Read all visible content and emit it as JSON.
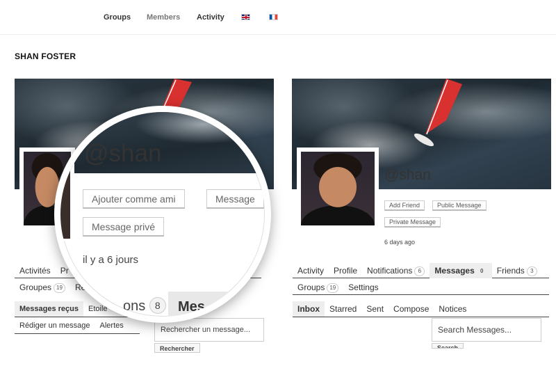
{
  "nav": {
    "items": [
      "Groups",
      "Members",
      "Activity"
    ],
    "flags": [
      "uk-flag",
      "fr-flag"
    ]
  },
  "page_title": "SHAN FOSTER",
  "left": {
    "tabs": [
      "Activités",
      "Pr"
    ],
    "tabs2": [
      "Groupes",
      "Ré"
    ],
    "groups_count": "19",
    "subnav": [
      "Messages reçus",
      "Etoilé"
    ],
    "subnav2": [
      "Rédiger un message",
      "Alertes"
    ],
    "search_placeholder": "Rechercher un message...",
    "search_button": "Rechercher"
  },
  "magnifier": {
    "handle": "@shan",
    "add_friend": "Ajouter comme ami",
    "message": "Message",
    "private_message": "Message privé",
    "last_active": "il y a 6 jours",
    "ons_text": "ons",
    "ons_count": "8",
    "mes_text": "Mes"
  },
  "right": {
    "handle": "@shan",
    "add_friend": "Add Friend",
    "public_message": "Public Message",
    "private_message": "Private Message",
    "last_active": "6 days ago",
    "tabs": {
      "activity": "Activity",
      "profile": "Profile",
      "notifications": "Notifications",
      "notifications_count": "6",
      "messages": "Messages",
      "messages_count": "0",
      "friends": "Friends",
      "friends_count": "3"
    },
    "tabs2": {
      "groups": "Groups",
      "groups_count": "19",
      "settings": "Settings"
    },
    "subnav": [
      "Inbox",
      "Starred",
      "Sent",
      "Compose",
      "Notices"
    ],
    "search_placeholder": "Search Messages...",
    "search_button": "Search"
  },
  "colors": {
    "sail": "#d9312f",
    "active_tab_bg": "#eeeeee"
  }
}
